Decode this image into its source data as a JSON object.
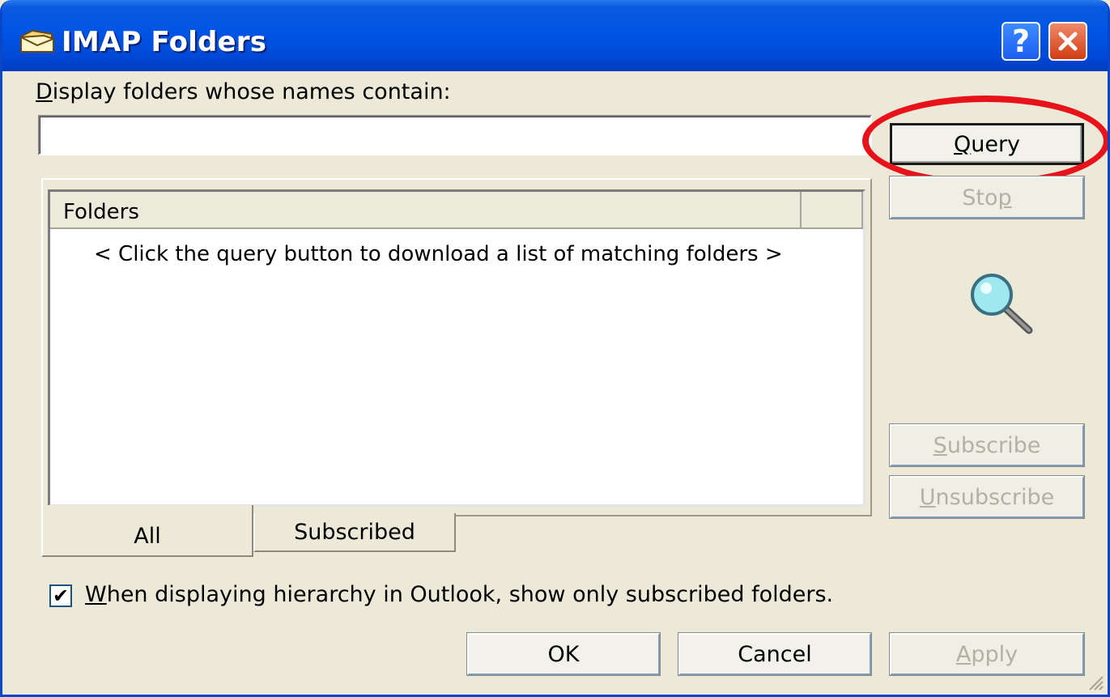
{
  "window": {
    "title": "IMAP Folders",
    "help_label": "?",
    "accent": "#0055e5"
  },
  "filter": {
    "label_accel": "D",
    "label_rest": "isplay folders whose names contain:",
    "value": "",
    "placeholder": ""
  },
  "buttons": {
    "query_accel": "Q",
    "query_rest": "uery",
    "stop_pre": "Sto",
    "stop_accel": "p",
    "subscribe_accel": "S",
    "subscribe_rest": "ubscribe",
    "unsubscribe_accel": "U",
    "unsubscribe_rest": "nsubscribe",
    "ok": "OK",
    "cancel": "Cancel",
    "apply_accel": "A",
    "apply_rest": "pply"
  },
  "list": {
    "columns": [
      "Folders",
      ""
    ],
    "empty_message": "< Click the query button to download a list of matching folders >"
  },
  "tabs": [
    {
      "label": "All",
      "selected": true
    },
    {
      "label": "Subscribed",
      "selected": false
    }
  ],
  "option": {
    "checked": true,
    "check_glyph": "✔",
    "label_accel": "W",
    "label_rest": "hen displaying hierarchy in Outlook, show only subscribed folders."
  },
  "annotation": {
    "color": "#e8131a"
  }
}
